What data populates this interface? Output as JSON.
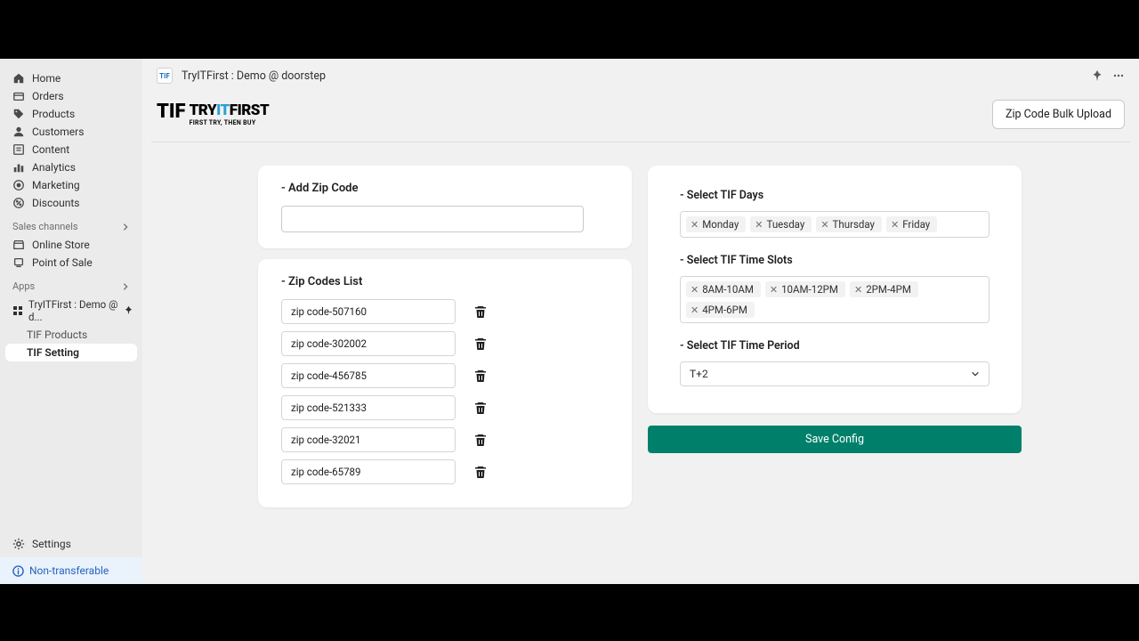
{
  "breadcrumb": {
    "title": "TryITFirst : Demo @ doorstep"
  },
  "logo": {
    "line1_a": "TRY",
    "line1_b": "IT",
    "line1_c": "FIRST",
    "slogan": "FIRST TRY, THEN BUY",
    "tif": "TIF"
  },
  "bulk_upload_label": "Zip Code Bulk Upload",
  "sidebar": {
    "items": [
      {
        "label": "Home"
      },
      {
        "label": "Orders"
      },
      {
        "label": "Products"
      },
      {
        "label": "Customers"
      },
      {
        "label": "Content"
      },
      {
        "label": "Analytics"
      },
      {
        "label": "Marketing"
      },
      {
        "label": "Discounts"
      }
    ],
    "sales_label": "Sales channels",
    "sales": [
      {
        "label": "Online Store"
      },
      {
        "label": "Point of Sale"
      }
    ],
    "apps_label": "Apps",
    "app_pinned": "TryITFirst : Demo @ d...",
    "app_sub": [
      {
        "label": "TIF Products"
      },
      {
        "label": "TIF Setting"
      }
    ],
    "settings": "Settings",
    "nontrans": "Non-transferable"
  },
  "add_zip": {
    "title": "- Add Zip Code"
  },
  "zip_list": {
    "title": "- Zip Codes List",
    "items": [
      {
        "label": "zip code-507160"
      },
      {
        "label": "zip code-302002"
      },
      {
        "label": "zip code-456785"
      },
      {
        "label": "zip code-521333"
      },
      {
        "label": "zip code-32021"
      },
      {
        "label": "zip code-65789"
      }
    ]
  },
  "tif_days": {
    "title": "- Select TIF Days",
    "chips": [
      "Monday",
      "Tuesday",
      "Thursday",
      "Friday"
    ]
  },
  "tif_slots": {
    "title": "- Select TIF Time Slots",
    "chips": [
      "8AM-10AM",
      "10AM-12PM",
      "2PM-4PM",
      "4PM-6PM"
    ]
  },
  "tif_period": {
    "title": "- Select TIF Time Period",
    "value": "T+2"
  },
  "save_label": "Save Config"
}
